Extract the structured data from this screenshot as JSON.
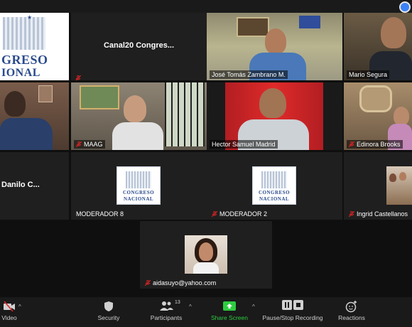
{
  "tiles": [
    {
      "id": "congreso-logo-1",
      "label": "",
      "logo_line1": "GRESO",
      "logo_line2": "IONAL"
    },
    {
      "id": "canal20",
      "label": "",
      "center_name": "Canal20 Congres..."
    },
    {
      "id": "jose-tomas",
      "label": "José Tomás Zambrano M."
    },
    {
      "id": "mario-segura",
      "label": "Mario Segura"
    },
    {
      "id": "participant-left-row2",
      "label": ""
    },
    {
      "id": "maag",
      "label": "MAAG"
    },
    {
      "id": "hector-samuel",
      "label": "Hector Samuel Madrid"
    },
    {
      "id": "edinora-brooks",
      "label": "Edinora Brooks"
    },
    {
      "id": "danilo",
      "label": "",
      "center_name": "Danilo C..."
    },
    {
      "id": "moderador-8",
      "label": "MODERADOR 8",
      "logo_line1": "CONGRESO",
      "logo_line2": "NACIONAL"
    },
    {
      "id": "moderador-2",
      "label": "MODERADOR 2",
      "logo_line1": "CONGRESO",
      "logo_line2": "NACIONAL"
    },
    {
      "id": "ingrid",
      "label": "Ingrid Castellanos"
    },
    {
      "id": "aidasuyo",
      "label": "aidasuyo@yahoo.com"
    }
  ],
  "toolbar": {
    "video_label": "Video",
    "security_label": "Security",
    "participants_label": "Participants",
    "participants_count": "13",
    "share_label": "Share Screen",
    "record_label": "Pause/Stop Recording",
    "reactions_label": "Reactions"
  },
  "colors": {
    "background": "#0f0f0f",
    "tile": "#1f1f1f",
    "active_speaker": "#f5e04a",
    "share_green": "#2ecc40",
    "muted_red": "#e02424"
  }
}
